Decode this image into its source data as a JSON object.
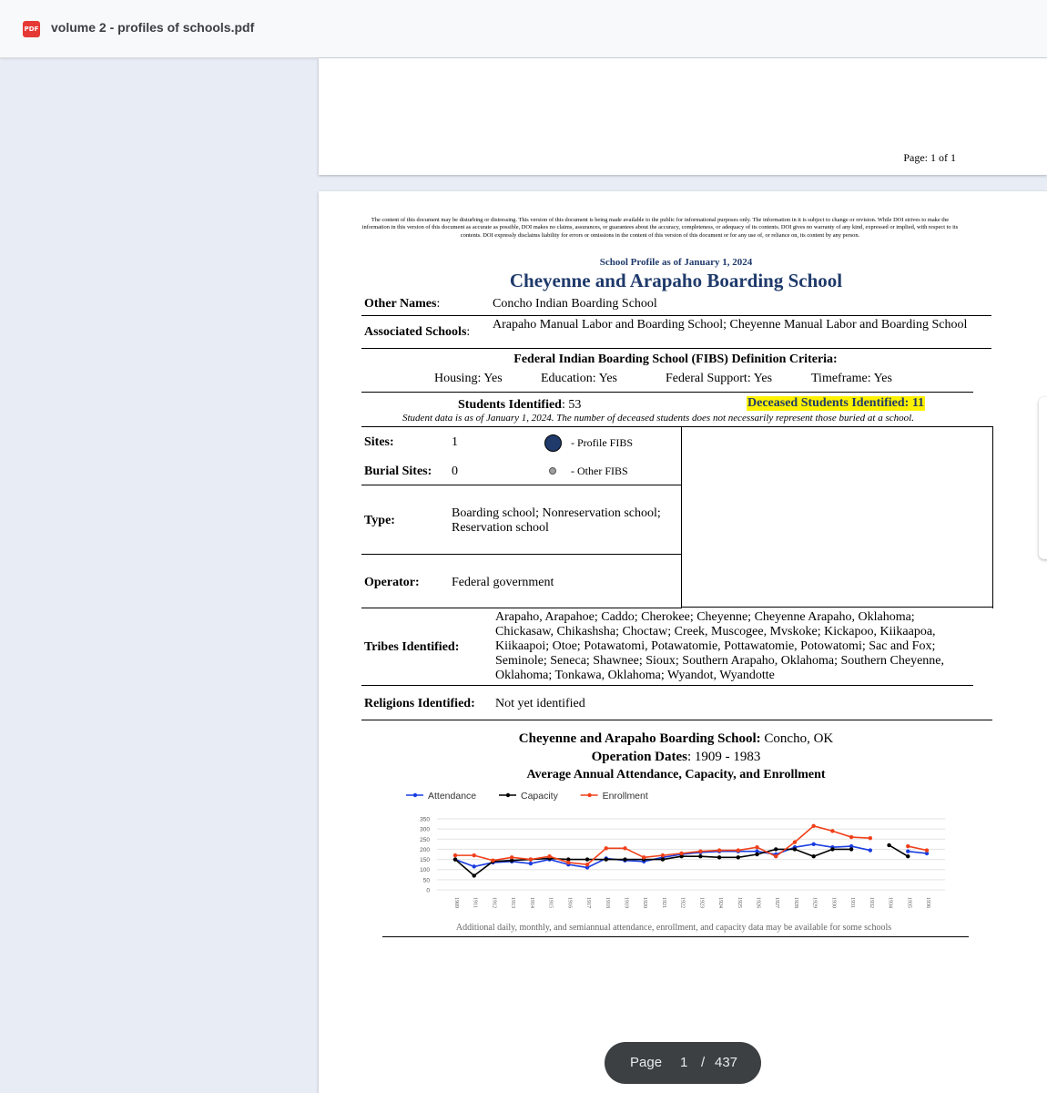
{
  "app": {
    "file_title": "volume 2 - profiles of schools.pdf",
    "badge": "PDF"
  },
  "prev_page": {
    "page_label": "Page: 1 of 1"
  },
  "doc": {
    "disclaimer": "The content of this document may be disturbing or distressing. This version of this document is being made available to the public for informational purposes only. The information in it is subject to change or revision. While DOI strives to make the information in this version of this document as accurate as possible, DOI makes no claims, assurances, or guarantees about the accuracy, completeness, or adequacy of its contents. DOI gives no warranty of any kind, expressed or implied, with respect to its contents. DOI expressly disclaims liability for errors or omissions in the content of this version of this document or for any use of, or reliance on, its content by any person.",
    "profile_asof": "School Profile as of January 1, 2024",
    "school_name": "Cheyenne and Arapaho Boarding School",
    "other_names_label": "Other Names",
    "other_names": "Concho Indian Boarding School",
    "assoc_label": "Associated Schools",
    "assoc": "Arapaho Manual Labor and Boarding School; Cheyenne Manual Labor and Boarding School",
    "fibs_title": "Federal Indian Boarding School (FIBS) Definition Criteria:",
    "criteria": {
      "housing": "Housing: Yes",
      "education": "Education: Yes",
      "federal_support": "Federal Support: Yes",
      "timeframe": "Timeframe: Yes"
    },
    "students_label": "Students Identified",
    "students_value": ": 53",
    "deceased": "Deceased Students Identified: 11",
    "note": "Student data is as of January 1, 2024. The number of deceased students does not necessarily represent those buried at a school.",
    "sites_label": "Sites:",
    "sites_value": "1",
    "burial_label": "Burial Sites:",
    "burial_value": "0",
    "legend_profile": "- Profile FIBS",
    "legend_other": "- Other FIBS",
    "type_label": "Type:",
    "type_line1": "Boarding school; Nonreservation school;",
    "type_line2": "Reservation school",
    "operator_label": "Operator:",
    "operator_value": "Federal government",
    "tribes_label": "Tribes Identified:",
    "tribes": [
      "Arapaho, Arapahoe; Caddo; Cherokee; Cheyenne; Cheyenne Arapaho, Oklahoma;",
      "Chickasaw, Chikashsha; Choctaw; Creek, Muscogee, Mvskoke; Kickapoo, Kiikaapoa,",
      "Kiikaapoi; Otoe; Potawatomi, Potawatomie, Pottawatomie, Potowatomi; Sac and Fox;",
      "Seminole; Seneca; Shawnee; Sioux; Southern Arapaho, Oklahoma; Southern Cheyenne,",
      "Oklahoma; Tonkawa, Oklahoma; Wyandot, Wyandotte"
    ],
    "religions_label": "Religions Identified:",
    "religions_value": "Not yet identified",
    "chart_school": "Cheyenne and Arapaho Boarding School:",
    "chart_location": " Concho, OK",
    "chart_dates_label": "Operation Dates",
    "chart_dates": ": 1909 - 1983",
    "chart_subtitle": "Average Annual Attendance, Capacity, and Enrollment",
    "chart_footnote": "Additional daily, monthly, and semiannual attendance, enrollment, and capacity data may be available for some schools"
  },
  "pager": {
    "label": "Page",
    "current": "1",
    "sep": "/",
    "total": "437"
  },
  "chart_data": {
    "type": "line",
    "title": "Average Annual Attendance, Capacity, and Enrollment",
    "x": [
      "1909",
      "1911",
      "1912",
      "1913",
      "1914",
      "1915",
      "1916",
      "1917",
      "1918",
      "1919",
      "1920",
      "1921",
      "1922",
      "1923",
      "1924",
      "1925",
      "1926",
      "1927",
      "1928",
      "1929",
      "1930",
      "1931",
      "1932",
      "1934",
      "1935",
      "1936"
    ],
    "ylim": [
      0,
      350
    ],
    "yticks": [
      0,
      50,
      100,
      150,
      200,
      250,
      300,
      350
    ],
    "legend_position": "top-left",
    "series": [
      {
        "name": "Attendance",
        "color": "#1a3de0",
        "values": [
          150,
          115,
          135,
          140,
          130,
          150,
          125,
          110,
          155,
          145,
          140,
          160,
          175,
          185,
          190,
          190,
          190,
          175,
          210,
          225,
          210,
          215,
          195,
          null,
          190,
          180
        ]
      },
      {
        "name": "Capacity",
        "color": "#000000",
        "values": [
          150,
          70,
          140,
          145,
          150,
          155,
          150,
          150,
          150,
          150,
          150,
          150,
          165,
          165,
          160,
          160,
          175,
          200,
          200,
          165,
          200,
          200,
          null,
          220,
          165,
          null
        ]
      },
      {
        "name": "Enrollment",
        "color": "#f0401a",
        "values": [
          170,
          170,
          145,
          160,
          150,
          165,
          135,
          125,
          205,
          205,
          160,
          170,
          180,
          190,
          195,
          195,
          210,
          165,
          235,
          315,
          290,
          260,
          255,
          null,
          215,
          195
        ]
      }
    ]
  }
}
